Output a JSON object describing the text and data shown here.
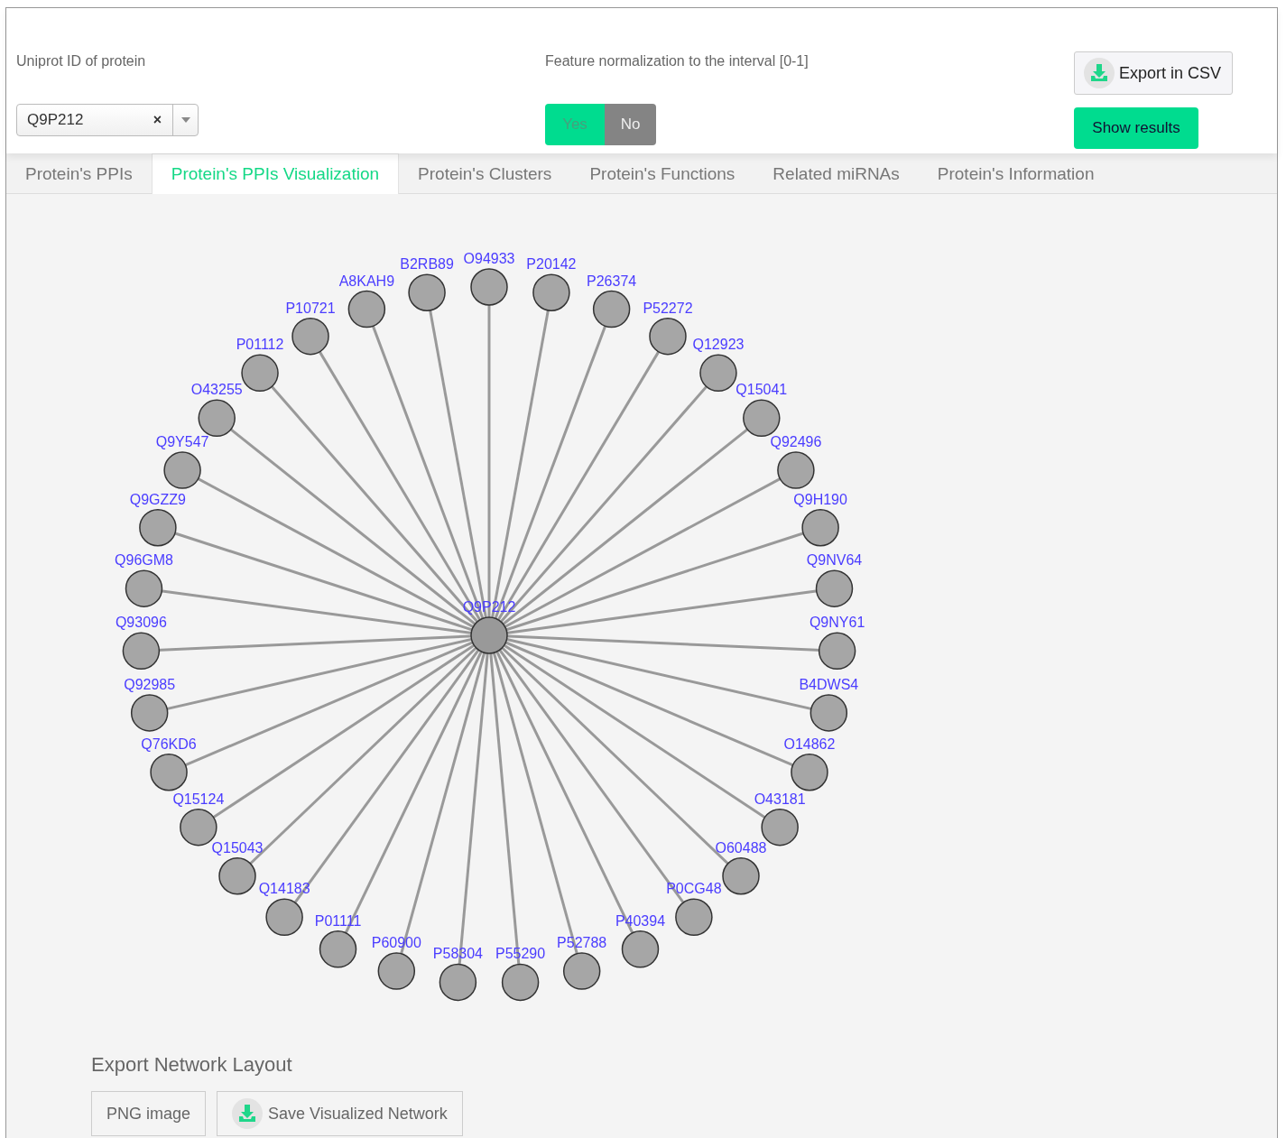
{
  "header": {
    "protein": {
      "label": "Uniprot ID of protein",
      "value": "Q9P212",
      "clear": "×"
    },
    "normalization": {
      "label": "Feature normalization to the interval [0-1]",
      "options": [
        {
          "label": "Yes",
          "selected": true
        },
        {
          "label": "No",
          "selected": false
        }
      ]
    },
    "export_button": "Export in CSV",
    "show_button": "Show results"
  },
  "tabs": [
    {
      "label": "Protein's PPIs",
      "selected": false
    },
    {
      "label": "Protein's PPIs Visualization",
      "selected": true
    },
    {
      "label": "Protein's Clusters",
      "selected": false
    },
    {
      "label": "Protein's Functions",
      "selected": false
    },
    {
      "label": "Related miRNAs",
      "selected": false
    },
    {
      "label": "Protein's Information",
      "selected": false
    }
  ],
  "network": {
    "center": "Q9P212",
    "right_nodes": [
      "O94933",
      "P20142",
      "P26374",
      "P52272",
      "Q12923",
      "Q15041",
      "Q92496",
      "Q9H190",
      "Q9NV64",
      "Q9NY61",
      "B4DWS4",
      "O14862",
      "O43181",
      "O60488",
      "P0CG48",
      "P40394",
      "P52788",
      "P55290"
    ],
    "left_nodes": [
      "B2RB89",
      "A8KAH9",
      "P10721",
      "P01112",
      "O43255",
      "Q9Y547",
      "Q9GZZ9",
      "Q96GM8",
      "Q93096",
      "Q92985",
      "Q76KD6",
      "Q15124",
      "Q15043",
      "Q14183",
      "P01111",
      "P60900",
      "P58304"
    ]
  },
  "export_layout": {
    "title": "Export Network Layout",
    "buttons": [
      {
        "label": "PNG image",
        "kind": "plain"
      },
      {
        "label": "Save Visualized Network",
        "kind": "download"
      }
    ]
  }
}
